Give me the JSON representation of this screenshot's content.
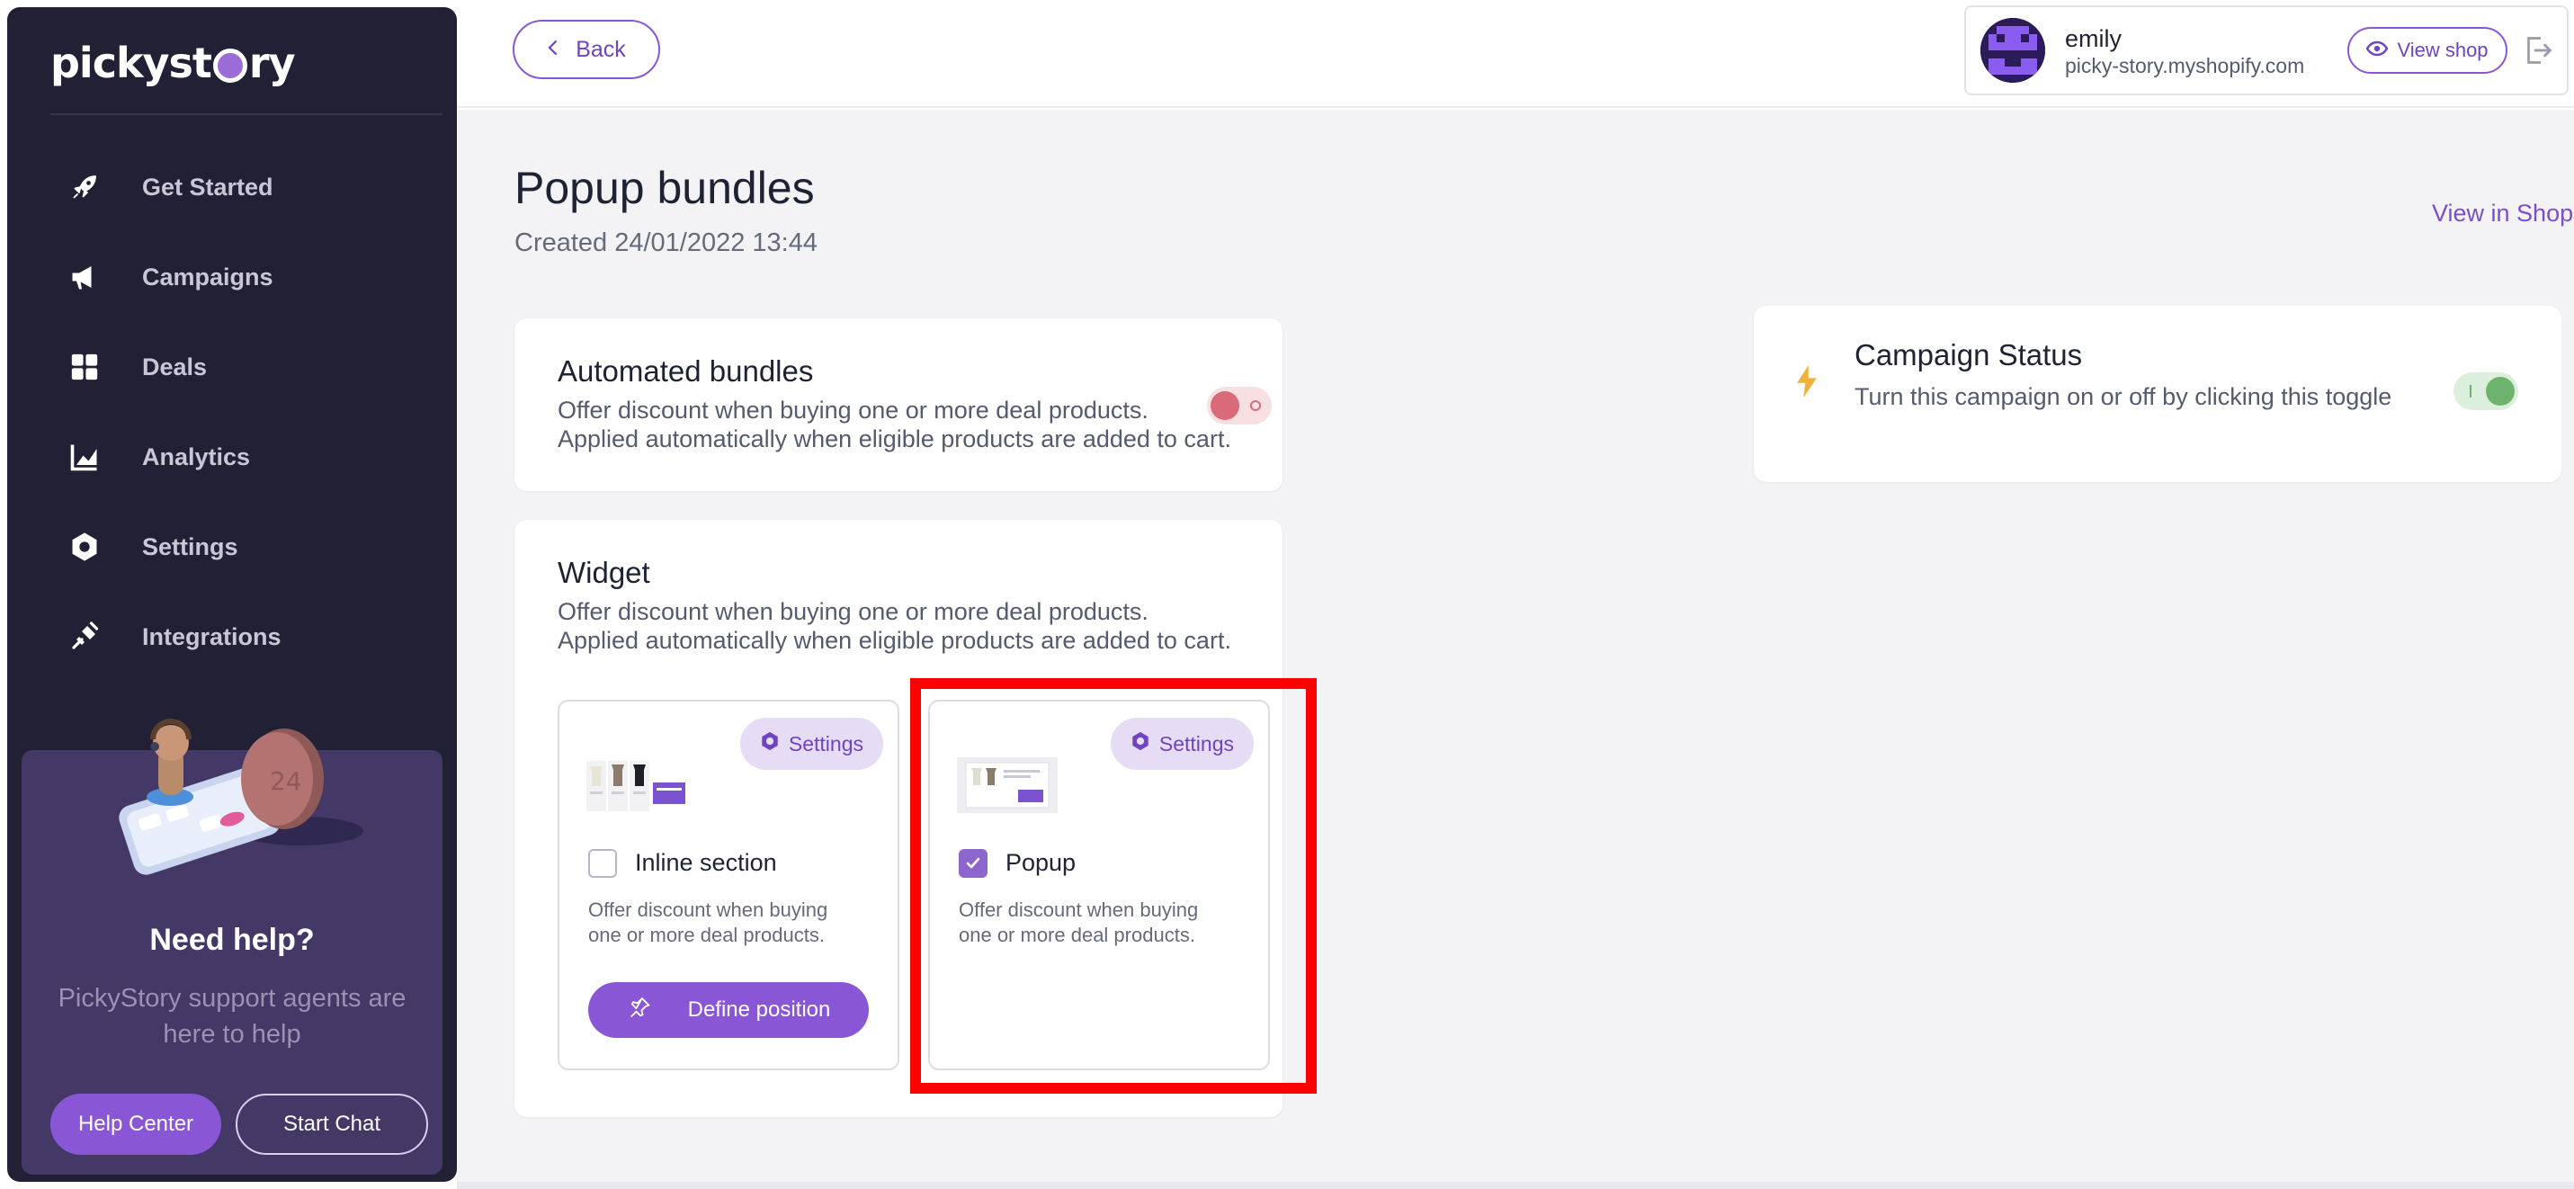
{
  "sidebar": {
    "logo": {
      "prefix": "pickyst",
      "suffix": "ry"
    },
    "items": [
      {
        "label": "Get Started",
        "icon": "rocket-icon"
      },
      {
        "label": "Campaigns",
        "icon": "megaphone-icon"
      },
      {
        "label": "Deals",
        "icon": "grid-icon"
      },
      {
        "label": "Analytics",
        "icon": "chart-icon"
      },
      {
        "label": "Settings",
        "icon": "gear-icon"
      },
      {
        "label": "Integrations",
        "icon": "plug-icon"
      }
    ],
    "help": {
      "title": "Need help?",
      "text": "PickyStory support agents are here to help",
      "help_center": "Help Center",
      "start_chat": "Start Chat"
    }
  },
  "header": {
    "back_label": "Back",
    "user_name": "emily",
    "shop_domain": "picky-story.myshopify.com",
    "view_shop_label": "View shop"
  },
  "page": {
    "title": "Popup bundles",
    "created": "Created 24/01/2022 13:44",
    "view_in_shop": "View in Shop"
  },
  "automated": {
    "title": "Automated bundles",
    "desc_line1": "Offer discount when buying one or more deal products.",
    "desc_line2": "Applied automatically when eligible products are added to cart.",
    "toggle_on": false
  },
  "status": {
    "title": "Campaign Status",
    "desc": "Turn this campaign on or off by clicking this toggle",
    "toggle_on": true
  },
  "widget": {
    "title": "Widget",
    "desc_line1": "Offer discount when buying one or more deal products.",
    "desc_line2": "Applied automatically when eligible products are added to cart.",
    "options": [
      {
        "label": "Inline section",
        "settings": "Settings",
        "desc_line1": "Offer discount when buying",
        "desc_line2": "one or more deal products.",
        "checked": false,
        "button": "Define position"
      },
      {
        "label": "Popup",
        "settings": "Settings",
        "desc_line1": "Offer discount when buying",
        "desc_line2": "one or more deal products.",
        "checked": true
      }
    ]
  },
  "colors": {
    "sidebar_bg": "#222034",
    "accent": "#8957d6",
    "highlight": "#ff0000",
    "toggle_off": "#d86b77",
    "toggle_on": "#6db36d"
  }
}
